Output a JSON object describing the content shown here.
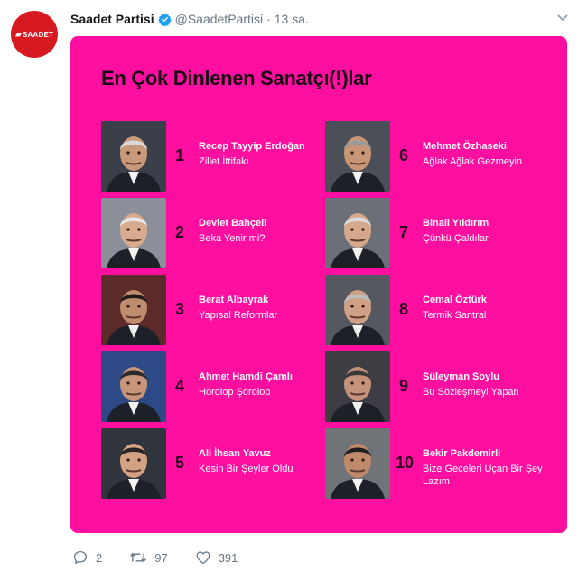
{
  "tweet": {
    "author_name": "Saadet Partisi",
    "handle": "@SaadetPartisi",
    "separator": "·",
    "time": "13 sa.",
    "avatar_text": "SAADET",
    "accent": "#d71920",
    "verified_color": "#1da1f2"
  },
  "card": {
    "title": "En Çok Dinlenen Sanatçı(!)lar",
    "background": "#ff0fa0",
    "items": [
      {
        "rank": "1",
        "name": "Recep Tayyip Erdoğan",
        "song": "Zillet İttifakı"
      },
      {
        "rank": "2",
        "name": "Devlet Bahçeli",
        "song": "Beka Yenir mi?"
      },
      {
        "rank": "3",
        "name": "Berat Albayrak",
        "song": "Yapısal Reformlar"
      },
      {
        "rank": "4",
        "name": "Ahmet Hamdi Çamlı",
        "song": "Horolop Şorolop"
      },
      {
        "rank": "5",
        "name": "Ali İhsan Yavuz",
        "song": "Kesin Bir Şeyler Oldu"
      },
      {
        "rank": "6",
        "name": "Mehmet Özhaseki",
        "song": "Ağlak Ağlak Gezmeyin"
      },
      {
        "rank": "7",
        "name": "Binali Yıldırım",
        "song": "Çünkü Çaldılar"
      },
      {
        "rank": "8",
        "name": "Cemal Öztürk",
        "song": "Termik Santral"
      },
      {
        "rank": "9",
        "name": "Süleyman Soylu",
        "song": "Bu Sözleşmeyi Yapan"
      },
      {
        "rank": "10",
        "name": "Bekir Pakdemirli",
        "song": "Bize Geceleri Uçan Bir Şey Lazım"
      }
    ]
  },
  "actions": {
    "replies": "2",
    "retweets": "97",
    "likes": "391"
  }
}
